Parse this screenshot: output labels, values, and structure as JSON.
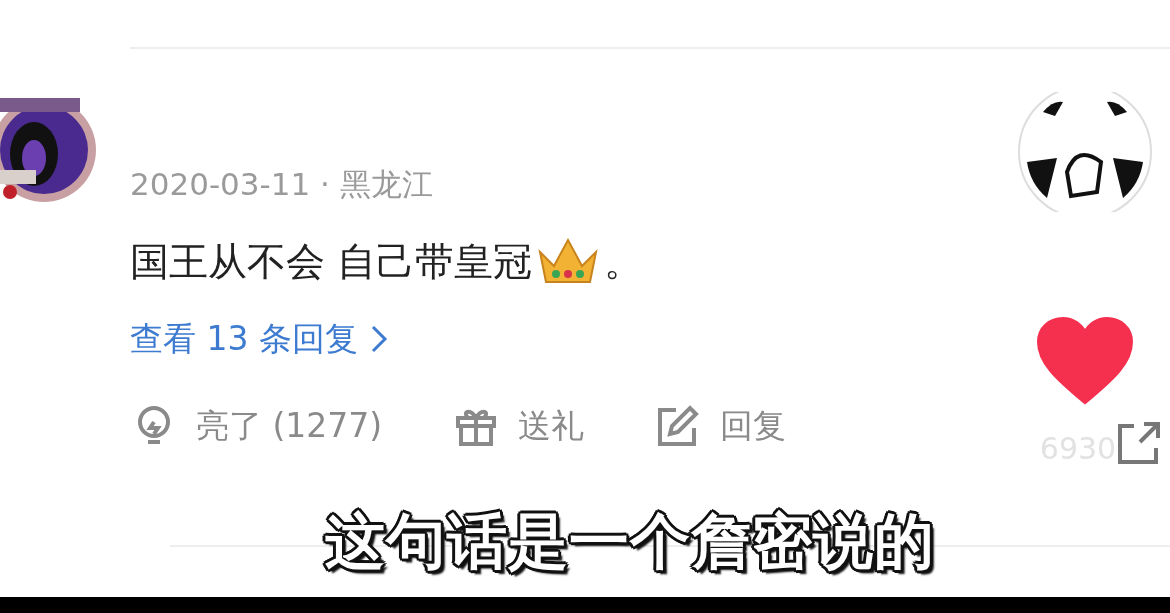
{
  "comment": {
    "meta": "2020-03-11 · 黑龙江",
    "text_before": "国王从不会 自己带皇冠",
    "text_after": "。",
    "replies_link": "查看 13 条回复",
    "actions": [
      {
        "kind": "light",
        "label": "亮了 (1277)"
      },
      {
        "kind": "gift",
        "label": "送礼"
      },
      {
        "kind": "reply",
        "label": "回复"
      }
    ]
  },
  "side": {
    "liked": true,
    "count": "6930"
  },
  "subtitle": "这句话是一个詹密说的"
}
